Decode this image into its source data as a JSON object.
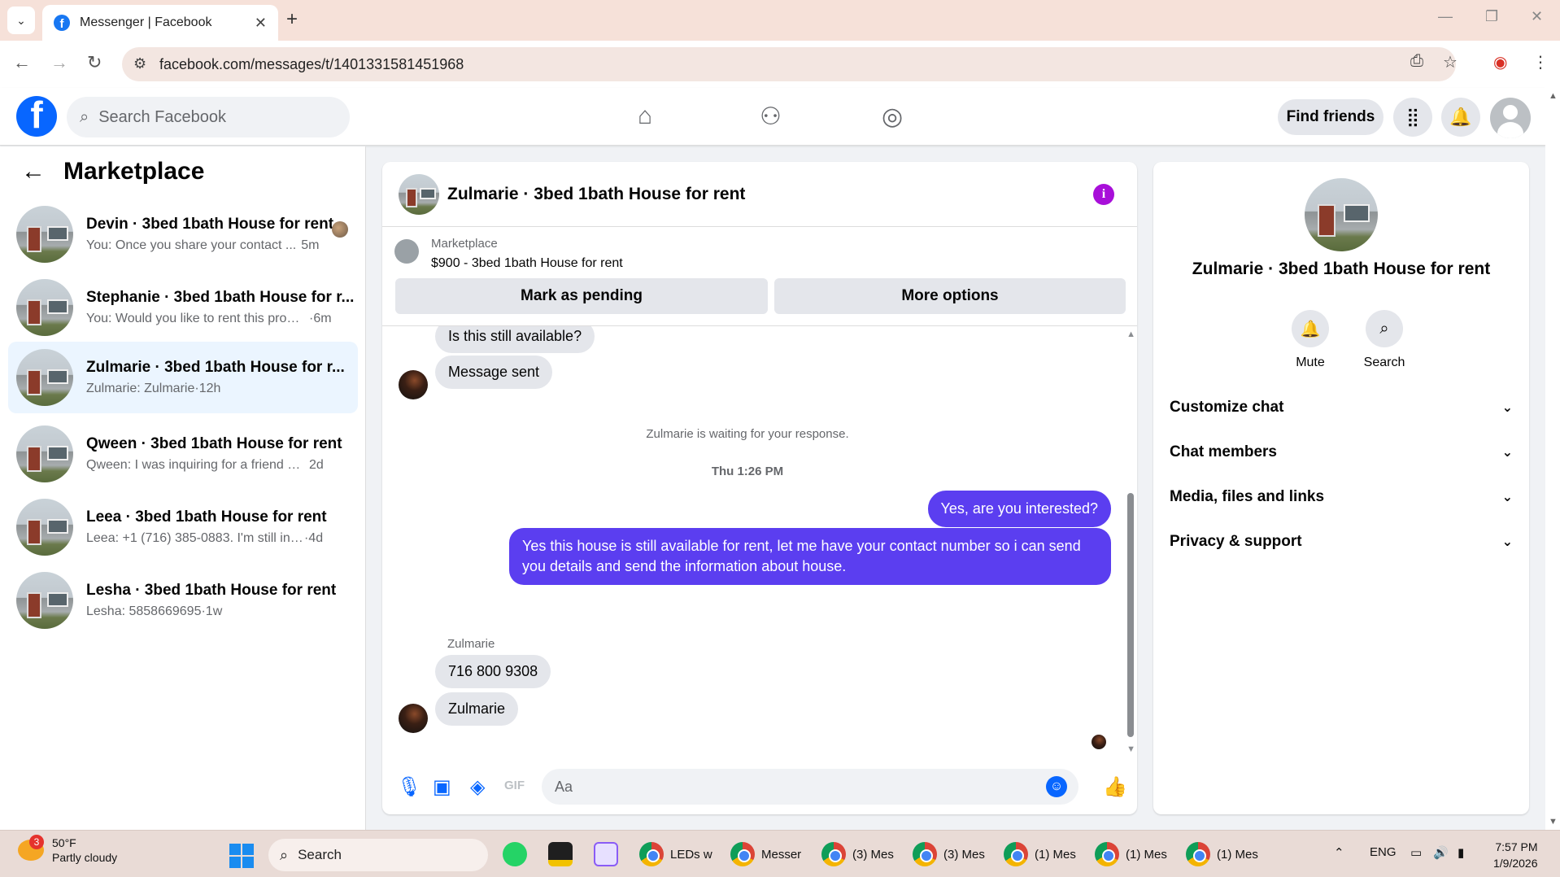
{
  "browser": {
    "tab_title": "Messenger | Facebook",
    "url": "facebook.com/messages/t/1401331581451968"
  },
  "fb_header": {
    "search_placeholder": "Search Facebook",
    "find_friends": "Find friends"
  },
  "sidebar": {
    "title": "Marketplace",
    "conversations": [
      {
        "name": "Devin · 3bed 1bath House for rent",
        "preview": "You: Once you share your contact ...",
        "time": "5m",
        "active": false
      },
      {
        "name": "Stephanie · 3bed 1bath House for r...",
        "preview": "You: Would you like to rent this prop...",
        "time": "·6m",
        "active": false
      },
      {
        "name": "Zulmarie · 3bed 1bath House for r...",
        "preview": "Zulmarie: Zulmarie",
        "time": "·12h",
        "active": true
      },
      {
        "name": "Qween · 3bed 1bath House for rent",
        "preview": "Qween: I was inquiring for a friend wh...",
        "time": "2d",
        "active": false
      },
      {
        "name": "Leea · 3bed 1bath House for rent",
        "preview": "Leea: +1 (716) 385-0883. I'm still inter...",
        "time": "·4d",
        "active": false
      },
      {
        "name": "Lesha · 3bed 1bath House for rent",
        "preview": "Lesha: 5858669695",
        "time": "·1w",
        "active": false
      }
    ]
  },
  "chat": {
    "title": "Zulmarie · 3bed 1bath House for rent",
    "marketplace_label": "Marketplace",
    "listing": "$900 - 3bed 1bath House for rent",
    "mark_pending": "Mark as pending",
    "more_options": "More options",
    "messages": {
      "in_1": "Is this still available?",
      "in_2": "Message sent",
      "waiting": "Zulmarie is waiting for your response.",
      "timestamp": "Thu 1:26 PM",
      "out_1": "Yes, are you interested?",
      "out_2": "Yes this house is still available for rent, let me have your contact number so i can send you details and send the information about house.",
      "sender_name": "Zulmarie",
      "in_3": "716 800 9308",
      "in_4": "Zulmarie"
    },
    "composer_placeholder": "Aa"
  },
  "right_panel": {
    "name": "Zulmarie · 3bed 1bath House for rent",
    "mute": "Mute",
    "search": "Search",
    "sections": [
      "Customize chat",
      "Chat members",
      "Media, files and links",
      "Privacy & support"
    ]
  },
  "taskbar": {
    "weather_badge": "3",
    "temp": "50°F",
    "condition": "Partly cloudy",
    "search": "Search",
    "apps": [
      "LEDs w",
      "Messer",
      "(3) Mes",
      "(3) Mes",
      "(1) Mes",
      "(1) Mes",
      "(1) Mes"
    ],
    "lang": "ENG",
    "time": "7:57 PM",
    "date": "1/9/2026"
  }
}
